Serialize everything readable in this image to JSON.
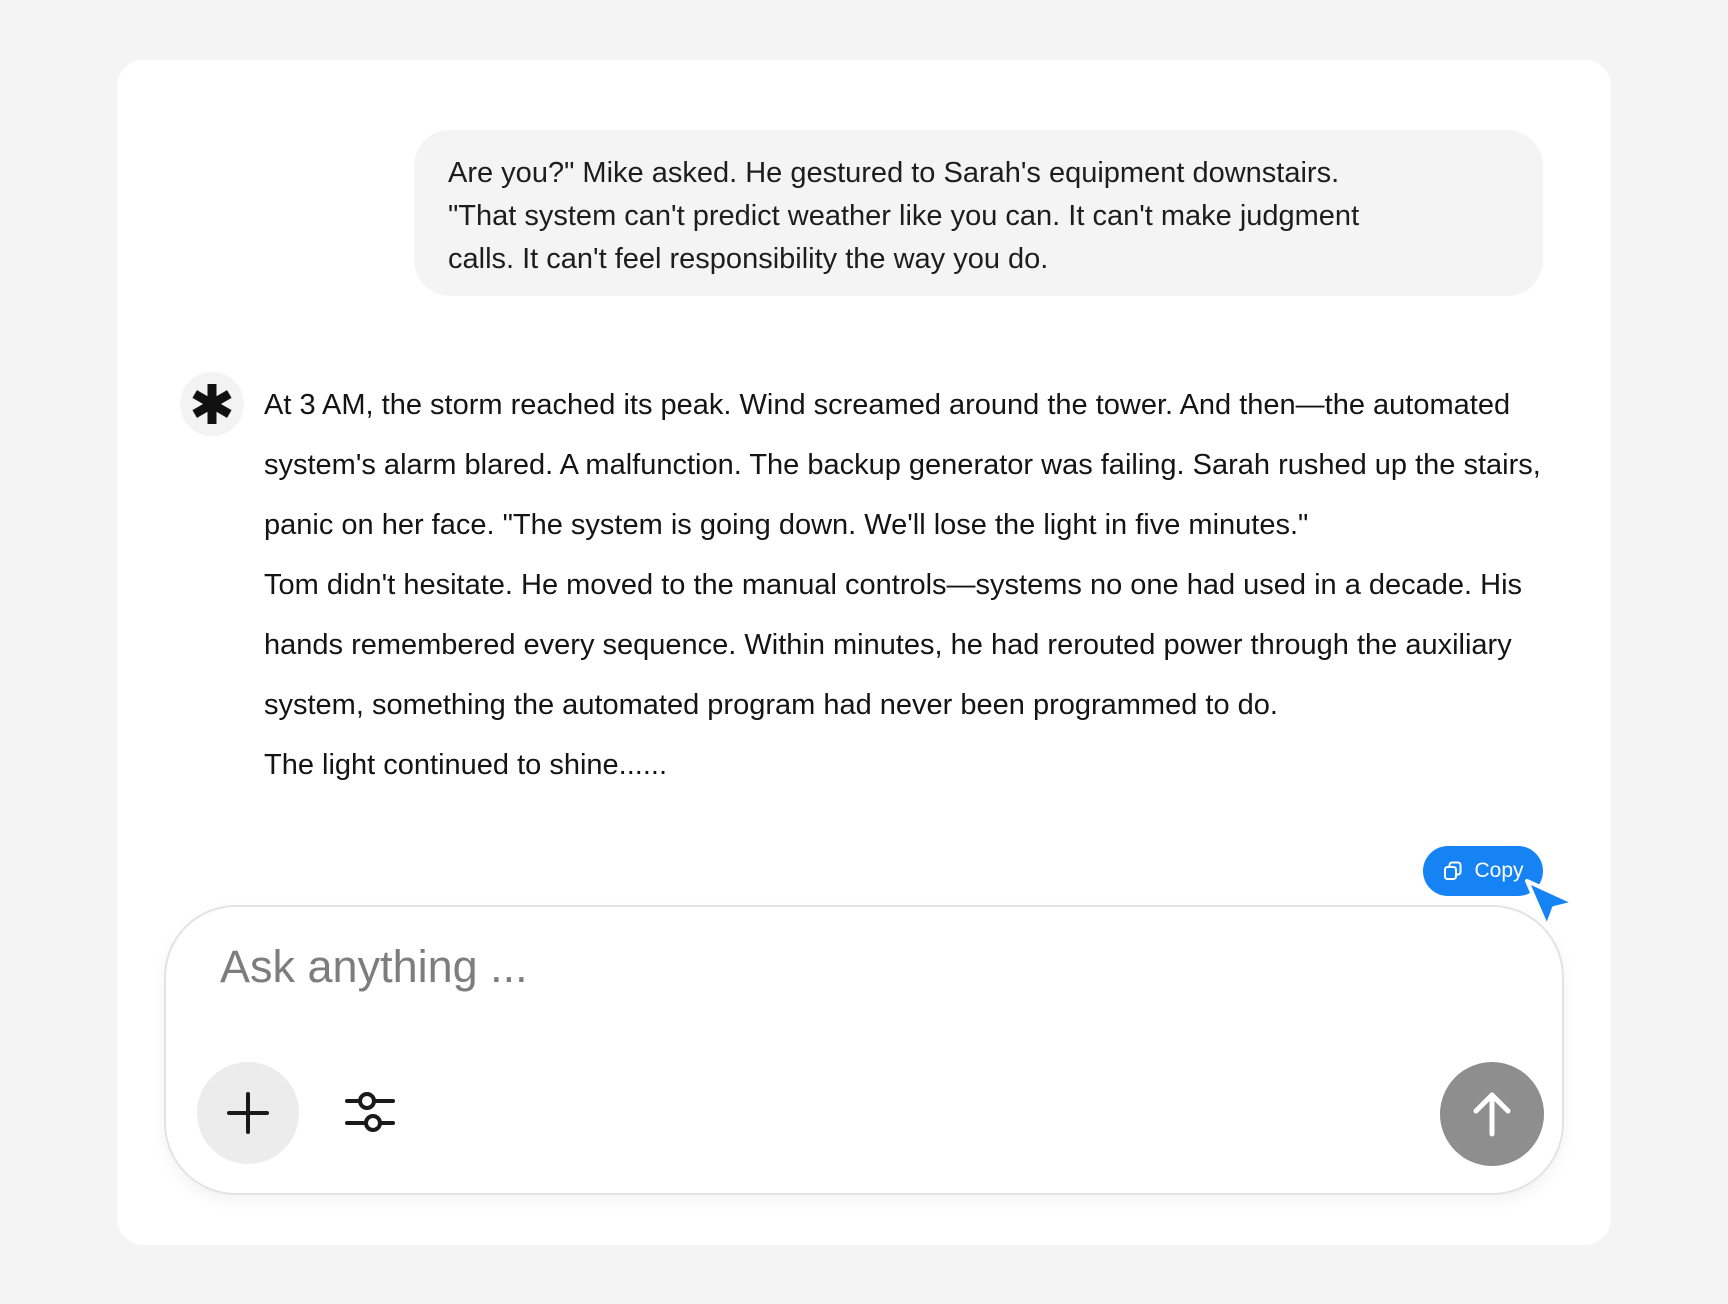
{
  "conversation": {
    "user_message": {
      "lines": [
        "Are you?\" Mike asked. He gestured to Sarah's equipment downstairs.",
        "\"That system can't predict weather like you can. It can't make judgment",
        "calls. It can't feel responsibility the way you do."
      ]
    },
    "assistant_message": {
      "avatar_icon": "asterisk-logo-icon",
      "paragraphs": [
        "At 3 AM, the storm reached its peak. Wind screamed around the tower. And then—the automated system's alarm blared. A malfunction. The backup generator was failing. Sarah rushed up the stairs, panic on her face. \"The system is going down. We'll lose the light in five minutes.\"",
        "Tom didn't hesitate. He moved to the manual controls—systems no one had used in a decade. His hands remembered every sequence. Within minutes, he had rerouted power through the auxiliary system, something the automated program had never been programmed to do.",
        "The light continued to shine......"
      ],
      "copy_button": {
        "label": "Copy",
        "icon": "copy-icon",
        "color": "#1683f5"
      }
    }
  },
  "composer": {
    "placeholder": "Ask anything ...",
    "value": "",
    "add_icon": "plus-icon",
    "settings_icon": "sliders-icon",
    "send_icon": "arrow-up-icon",
    "send_color": "#8e8e8e"
  },
  "cursor": {
    "icon": "pointer-cursor-icon",
    "color": "#1683f5"
  }
}
